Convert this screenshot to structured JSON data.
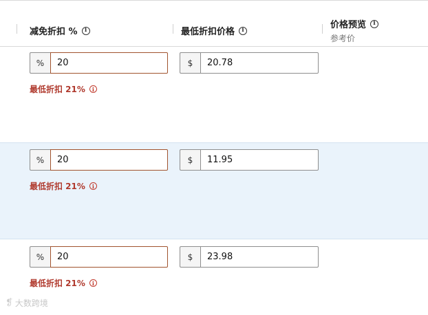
{
  "header": {
    "columns": [
      {
        "title": "减免折扣 %"
      },
      {
        "title": "最低折扣价格"
      },
      {
        "title": "价格预览",
        "subtitle": "参考价"
      }
    ]
  },
  "rows": [
    {
      "percent_symbol": "%",
      "discount_value": "20",
      "warning": "最低折扣 21%",
      "currency_symbol": "$",
      "min_price": "20.78"
    },
    {
      "percent_symbol": "%",
      "discount_value": "20",
      "warning": "最低折扣 21%",
      "currency_symbol": "$",
      "min_price": "11.95"
    },
    {
      "percent_symbol": "%",
      "discount_value": "20",
      "warning": "最低折扣 21%",
      "currency_symbol": "$",
      "min_price": "23.98"
    }
  ],
  "watermark": {
    "text": "大数跨境"
  },
  "icons": {
    "info": "info-icon",
    "warning_info": "warning-info-icon"
  },
  "colors": {
    "row_highlight": "#eaf3fb",
    "warning_text": "#b03a2e",
    "error_border": "#a0522d"
  }
}
